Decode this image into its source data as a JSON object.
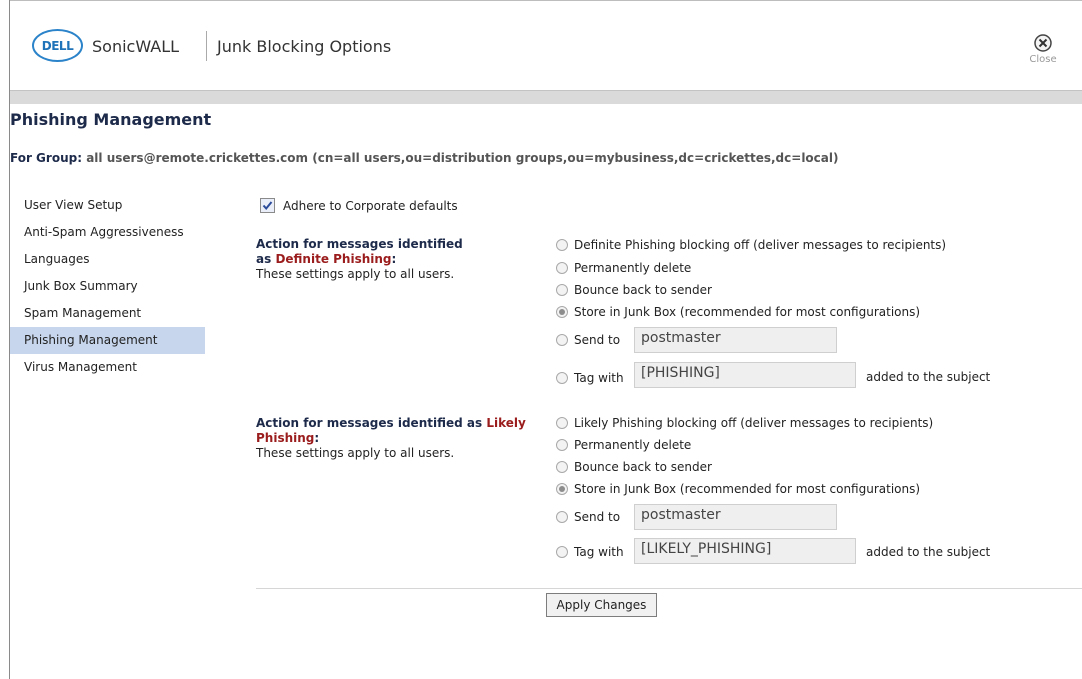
{
  "header": {
    "logo_text": "DELL",
    "brand": "SonicWALL",
    "title": "Junk Blocking Options",
    "close_label": "Close"
  },
  "page": {
    "title": "Phishing Management",
    "group_label": "For Group:",
    "group_value": "all users@remote.crickettes.com (cn=all users,ou=distribution groups,ou=mybusiness,dc=crickettes,dc=local)"
  },
  "sidebar": {
    "items": [
      {
        "label": "User View Setup"
      },
      {
        "label": "Anti-Spam Aggressiveness"
      },
      {
        "label": "Languages"
      },
      {
        "label": "Junk Box Summary"
      },
      {
        "label": "Spam Management"
      },
      {
        "label": "Phishing Management",
        "active": true
      },
      {
        "label": "Virus Management"
      }
    ]
  },
  "corporate_defaults": {
    "label": "Adhere to Corporate defaults",
    "checked": true
  },
  "definite": {
    "heading_1": "Action for messages identified",
    "heading_2": "as",
    "heading_red": "Definite Phishing",
    "heading_colon": ":",
    "note": "These settings apply to all users.",
    "options": [
      "Definite Phishing blocking off (deliver messages to recipients)",
      "Permanently delete",
      "Bounce back to sender",
      "Store in Junk Box (recommended for most configurations)"
    ],
    "selected": 3,
    "send_to_label": "Send to",
    "send_to_value": "postmaster",
    "tag_label": "Tag with",
    "tag_value": "[PHISHING]",
    "tag_suffix": "added to the subject"
  },
  "likely": {
    "heading_1": "Action for messages identified as",
    "heading_red_1": "Likely",
    "heading_red_2": "Phishing",
    "heading_colon": ":",
    "note": "These settings apply to all users.",
    "options": [
      "Likely Phishing blocking off (deliver messages to recipients)",
      "Permanently delete",
      "Bounce back to sender",
      "Store in Junk Box (recommended for most configurations)"
    ],
    "selected": 3,
    "send_to_label": "Send to",
    "send_to_value": "postmaster",
    "tag_label": "Tag with",
    "tag_value": "[LIKELY_PHISHING]",
    "tag_suffix": "added to the subject"
  },
  "apply_label": "Apply Changes",
  "colors": {
    "accent": "#2b83c9",
    "sidebar_active": "#c7d6ec",
    "phishing_red": "#9b1c1c"
  }
}
